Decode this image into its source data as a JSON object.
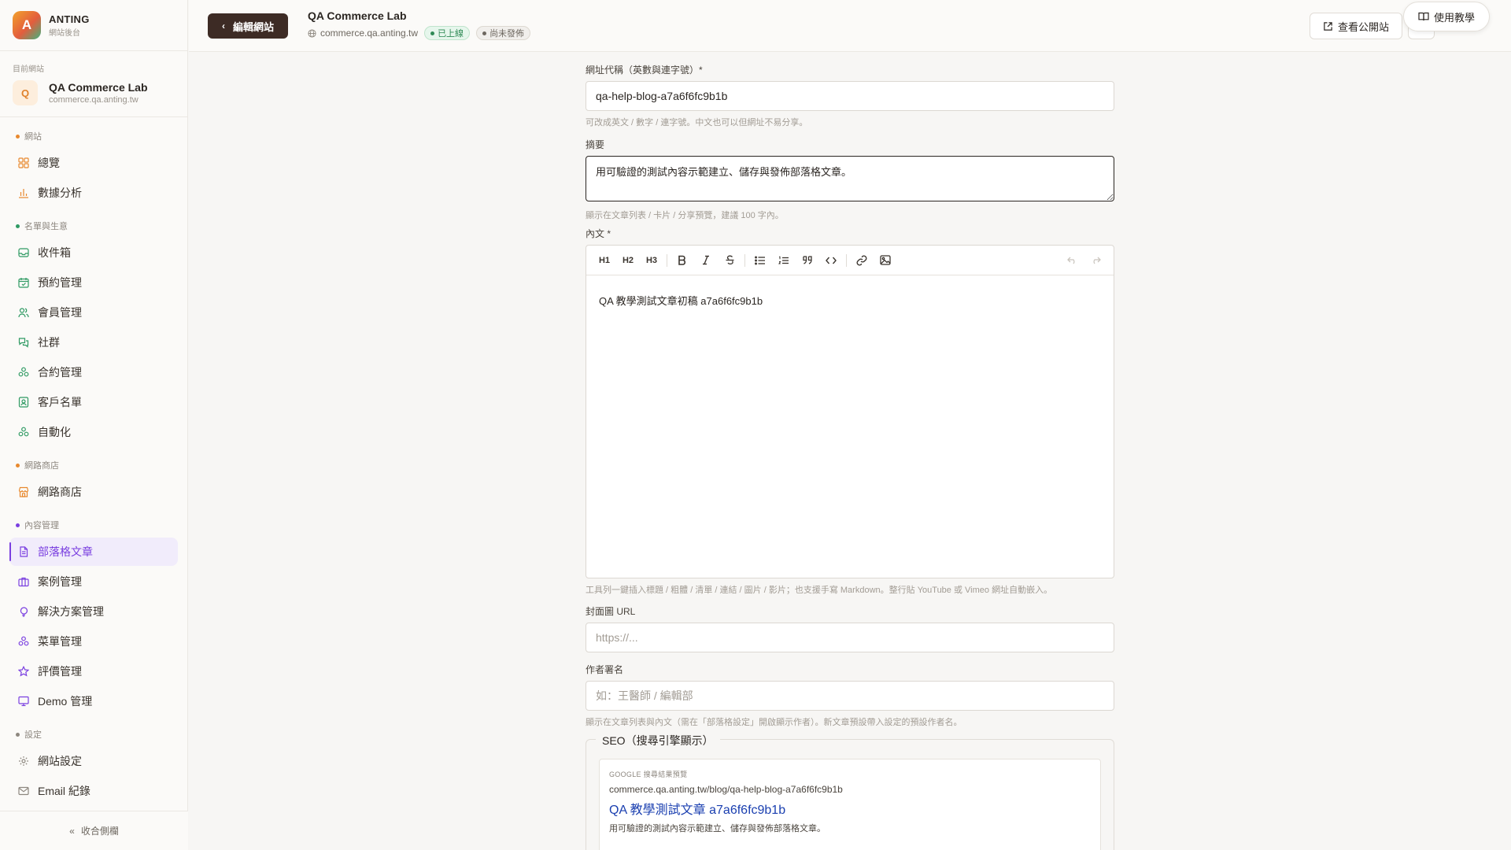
{
  "brand": {
    "logo_letter": "A",
    "name": "ANTING",
    "subtitle": "網站後台"
  },
  "current_site": {
    "label": "目前網站",
    "icon_letter": "Q",
    "name": "QA Commerce Lab",
    "domain": "commerce.qa.anting.tw"
  },
  "nav": {
    "sections": [
      {
        "label": "網站",
        "dot_color": "#e8892e",
        "items": [
          {
            "label": "總覽",
            "icon": "grid-icon"
          },
          {
            "label": "數據分析",
            "icon": "chart-icon"
          }
        ]
      },
      {
        "label": "名單與生意",
        "dot_color": "#2f9a63",
        "items": [
          {
            "label": "收件箱",
            "icon": "inbox-icon"
          },
          {
            "label": "預約管理",
            "icon": "calendar-icon"
          },
          {
            "label": "會員管理",
            "icon": "users-icon"
          },
          {
            "label": "社群",
            "icon": "chat-icon"
          },
          {
            "label": "合約管理",
            "icon": "cluster-icon"
          },
          {
            "label": "客戶名單",
            "icon": "contact-icon"
          },
          {
            "label": "自動化",
            "icon": "cluster-icon"
          }
        ]
      },
      {
        "label": "網路商店",
        "dot_color": "#e8892e",
        "items": [
          {
            "label": "網路商店",
            "icon": "store-icon"
          }
        ]
      },
      {
        "label": "內容管理",
        "dot_color": "#7a3fe0",
        "items": [
          {
            "label": "部落格文章",
            "icon": "document-icon",
            "active": true
          },
          {
            "label": "案例管理",
            "icon": "briefcase-icon"
          },
          {
            "label": "解決方案管理",
            "icon": "bulb-icon"
          },
          {
            "label": "菜單管理",
            "icon": "cluster-icon"
          },
          {
            "label": "評價管理",
            "icon": "star-icon"
          },
          {
            "label": "Demo 管理",
            "icon": "monitor-icon"
          }
        ]
      },
      {
        "label": "設定",
        "dot_color": "#8d877f",
        "items": [
          {
            "label": "網站設定",
            "icon": "gear-icon"
          },
          {
            "label": "Email 紀錄",
            "icon": "mail-icon"
          }
        ]
      }
    ],
    "collapse_label": "收合側欄"
  },
  "topbar": {
    "back_label": "編輯網站",
    "project_name": "QA Commerce Lab",
    "project_domain": "commerce.qa.anting.tw",
    "status_live": "已上線",
    "status_draft": "尚未發佈",
    "view_site_label": "查看公開站",
    "tutorial_label": "使用教學"
  },
  "form": {
    "slug": {
      "label": "網址代稱（英數與連字號）*",
      "value": "qa-help-blog-a7a6f6fc9b1b",
      "hint": "可改成英文 / 數字 / 連字號。中文也可以但網址不易分享。"
    },
    "summary": {
      "label": "摘要",
      "value": "用可驗證的測試內容示範建立、儲存與發佈部落格文章。",
      "hint": "顯示在文章列表 / 卡片 / 分享預覽，建議 100 字內。"
    },
    "body": {
      "label": "內文 *",
      "toolbar": [
        "H1",
        "H2",
        "H3"
      ],
      "content": "QA 教學測試文章初稿 a7a6f6fc9b1b",
      "hint": "工具列一鍵插入標題 / 粗體 / 清單 / 連結 / 圖片 / 影片；也支援手寫 Markdown。整行貼 YouTube 或 Vimeo 網址自動嵌入。"
    },
    "cover": {
      "label": "封面圖 URL",
      "placeholder": "https://..."
    },
    "author": {
      "label": "作者署名",
      "placeholder": "如：王醫師 / 編輯部",
      "hint": "顯示在文章列表與內文（需在「部落格設定」開啟顯示作者）。新文章預設帶入設定的預設作者名。"
    },
    "seo": {
      "legend": "SEO（搜尋引擎顯示）",
      "preview_label": "GOOGLE 搜尋結果預覽",
      "preview_url": "commerce.qa.anting.tw/blog/qa-help-blog-a7a6f6fc9b1b",
      "preview_title": "QA 教學測試文章 a7a6f6fc9b1b",
      "preview_desc": "用可驗證的測試內容示範建立、儲存與發佈部落格文章。"
    }
  }
}
